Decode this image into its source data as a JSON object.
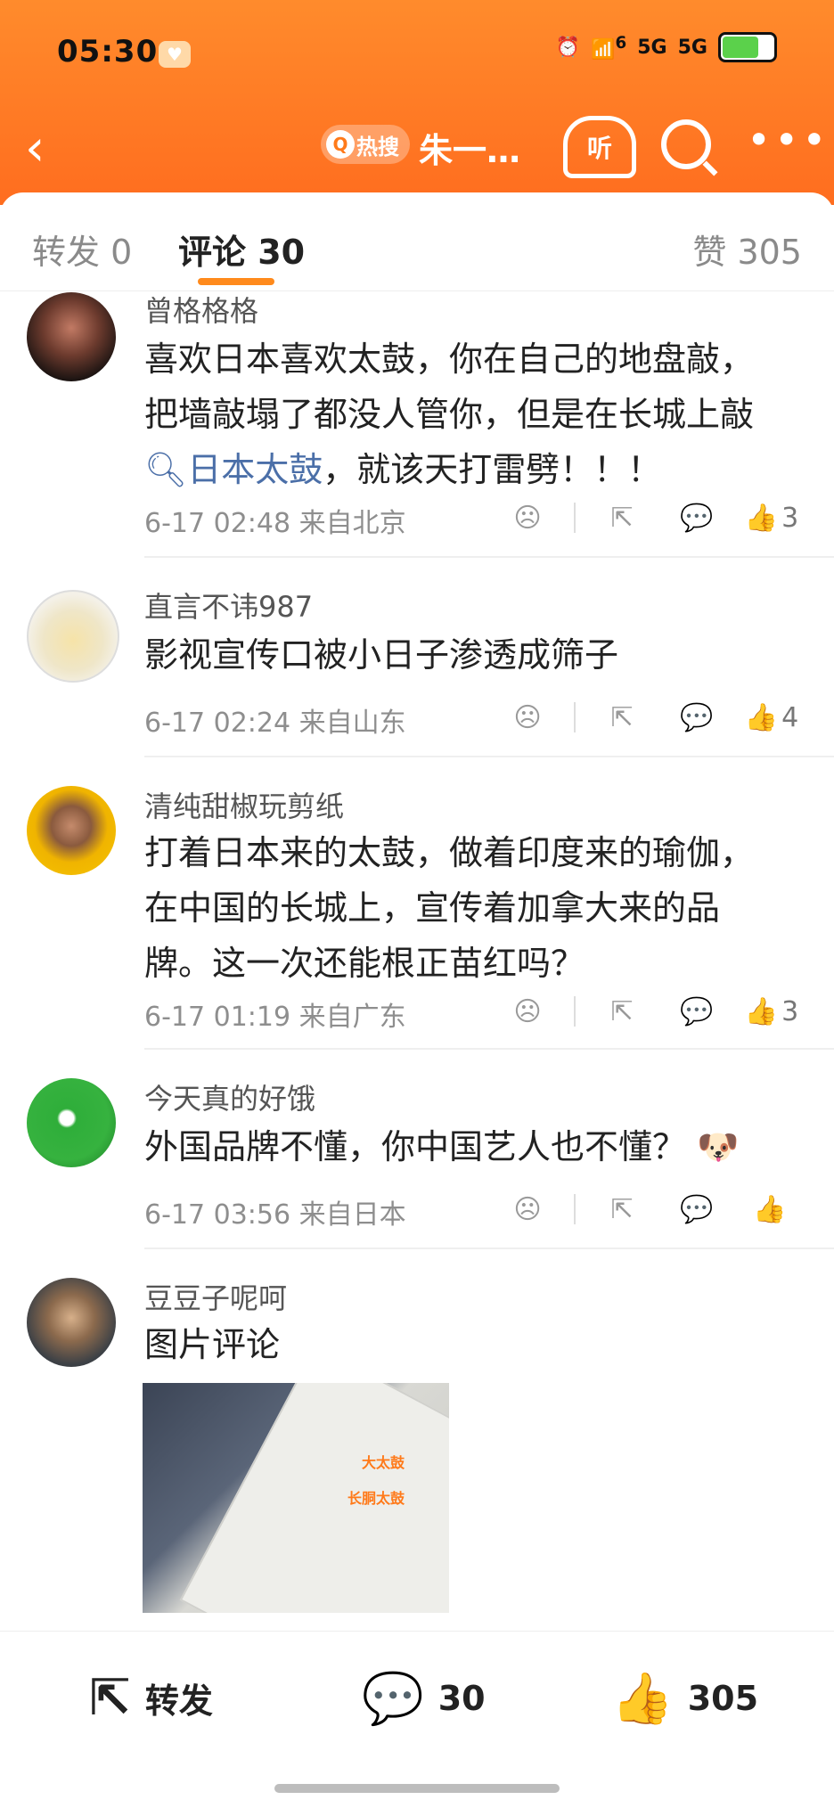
{
  "status": {
    "time": "05:30",
    "network_a": "5G",
    "network_b": "5G",
    "wifi_label": "6"
  },
  "nav": {
    "hot_label": "热搜",
    "topic": "朱一…",
    "listen_label": "听"
  },
  "tabs": {
    "repost": "转发 0",
    "comments": "评论 30",
    "likes": "赞 305"
  },
  "comments": [
    {
      "name": "曾格格格",
      "text_pre": "喜欢日本喜欢太鼓，你在自己的地盘敲，把墙敲塌了都没人管你，但是在长城上敲",
      "link": "日本太鼓",
      "text_post": "，就该天打雷劈！！！",
      "time": "6-17 02:48",
      "location": "来自北京",
      "likes": "3"
    },
    {
      "name": "直言不讳987",
      "text": "影视宣传口被小日子渗透成筛子",
      "time": "6-17 02:24",
      "location": "来自山东",
      "likes": "4"
    },
    {
      "name": "清纯甜椒玩剪纸",
      "text": "打着日本来的太鼓，做着印度来的瑜伽，在中国的长城上，宣传着加拿大来的品牌。这一次还能根正苗红吗？",
      "time": "6-17 01:19",
      "location": "来自广东",
      "likes": "3"
    },
    {
      "name": "今天真的好饿",
      "text": "外国品牌不懂，你中国艺人也不懂？",
      "time": "6-17 03:56",
      "location": "来自日本",
      "likes": ""
    },
    {
      "name": "豆豆子呢呵",
      "text": "图片评论",
      "image_labels": [
        "大太鼓",
        "长胴太鼓"
      ]
    }
  ],
  "bottom": {
    "repost": "转发",
    "comments": "30",
    "likes": "305"
  },
  "colors": {
    "header": "#ff7a22",
    "accent": "#ff8a1c",
    "link": "#4b6fa8"
  }
}
